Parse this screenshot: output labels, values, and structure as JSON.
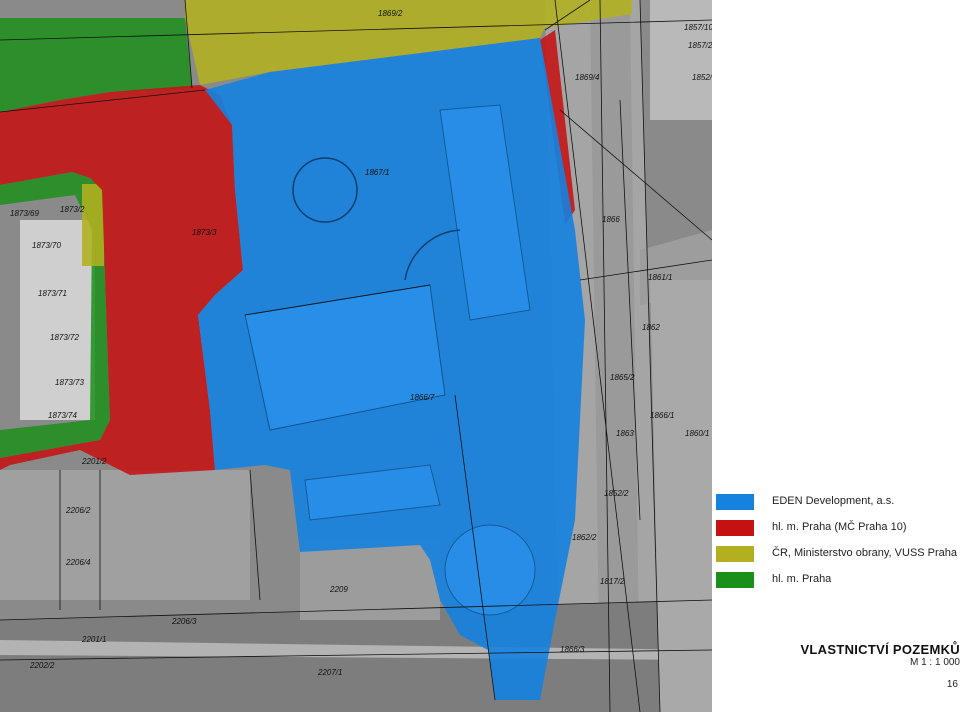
{
  "map": {
    "parcel_labels": [
      "1869/2",
      "1857/10",
      "1857/2",
      "1869/4",
      "1852/8",
      "1866",
      "1867/1",
      "1873/3",
      "1873/70",
      "1873/71",
      "1873/72",
      "1873/73",
      "1873/74",
      "1873/69",
      "1873/2",
      "1861/1",
      "1862",
      "1865/2",
      "1866/1",
      "1863",
      "1860/1",
      "1866/7",
      "1852/2",
      "1862/2",
      "1817/2",
      "1866/3",
      "2209",
      "2206/2",
      "2206/4",
      "2206/3",
      "2201/1",
      "2202/2",
      "2207/1",
      "2201/2"
    ],
    "colors": {
      "eden": "#1582e0",
      "praha10": "#c41212",
      "cr_vuss": "#b2b01f",
      "praha": "#1b8f1b"
    }
  },
  "legend": {
    "items": [
      {
        "label": "EDEN Development, a.s.",
        "color": "#1582e0"
      },
      {
        "label": "hl. m. Praha (MČ Praha 10)",
        "color": "#c41212"
      },
      {
        "label": "ČR, Ministerstvo obrany, VUSS Praha",
        "color": "#b2b01f"
      },
      {
        "label": "hl. m. Praha",
        "color": "#1b8f1b"
      }
    ]
  },
  "title": "VLASTNICTVÍ POZEMKŮ",
  "scale": "M 1 : 1 000",
  "page_number": "16"
}
